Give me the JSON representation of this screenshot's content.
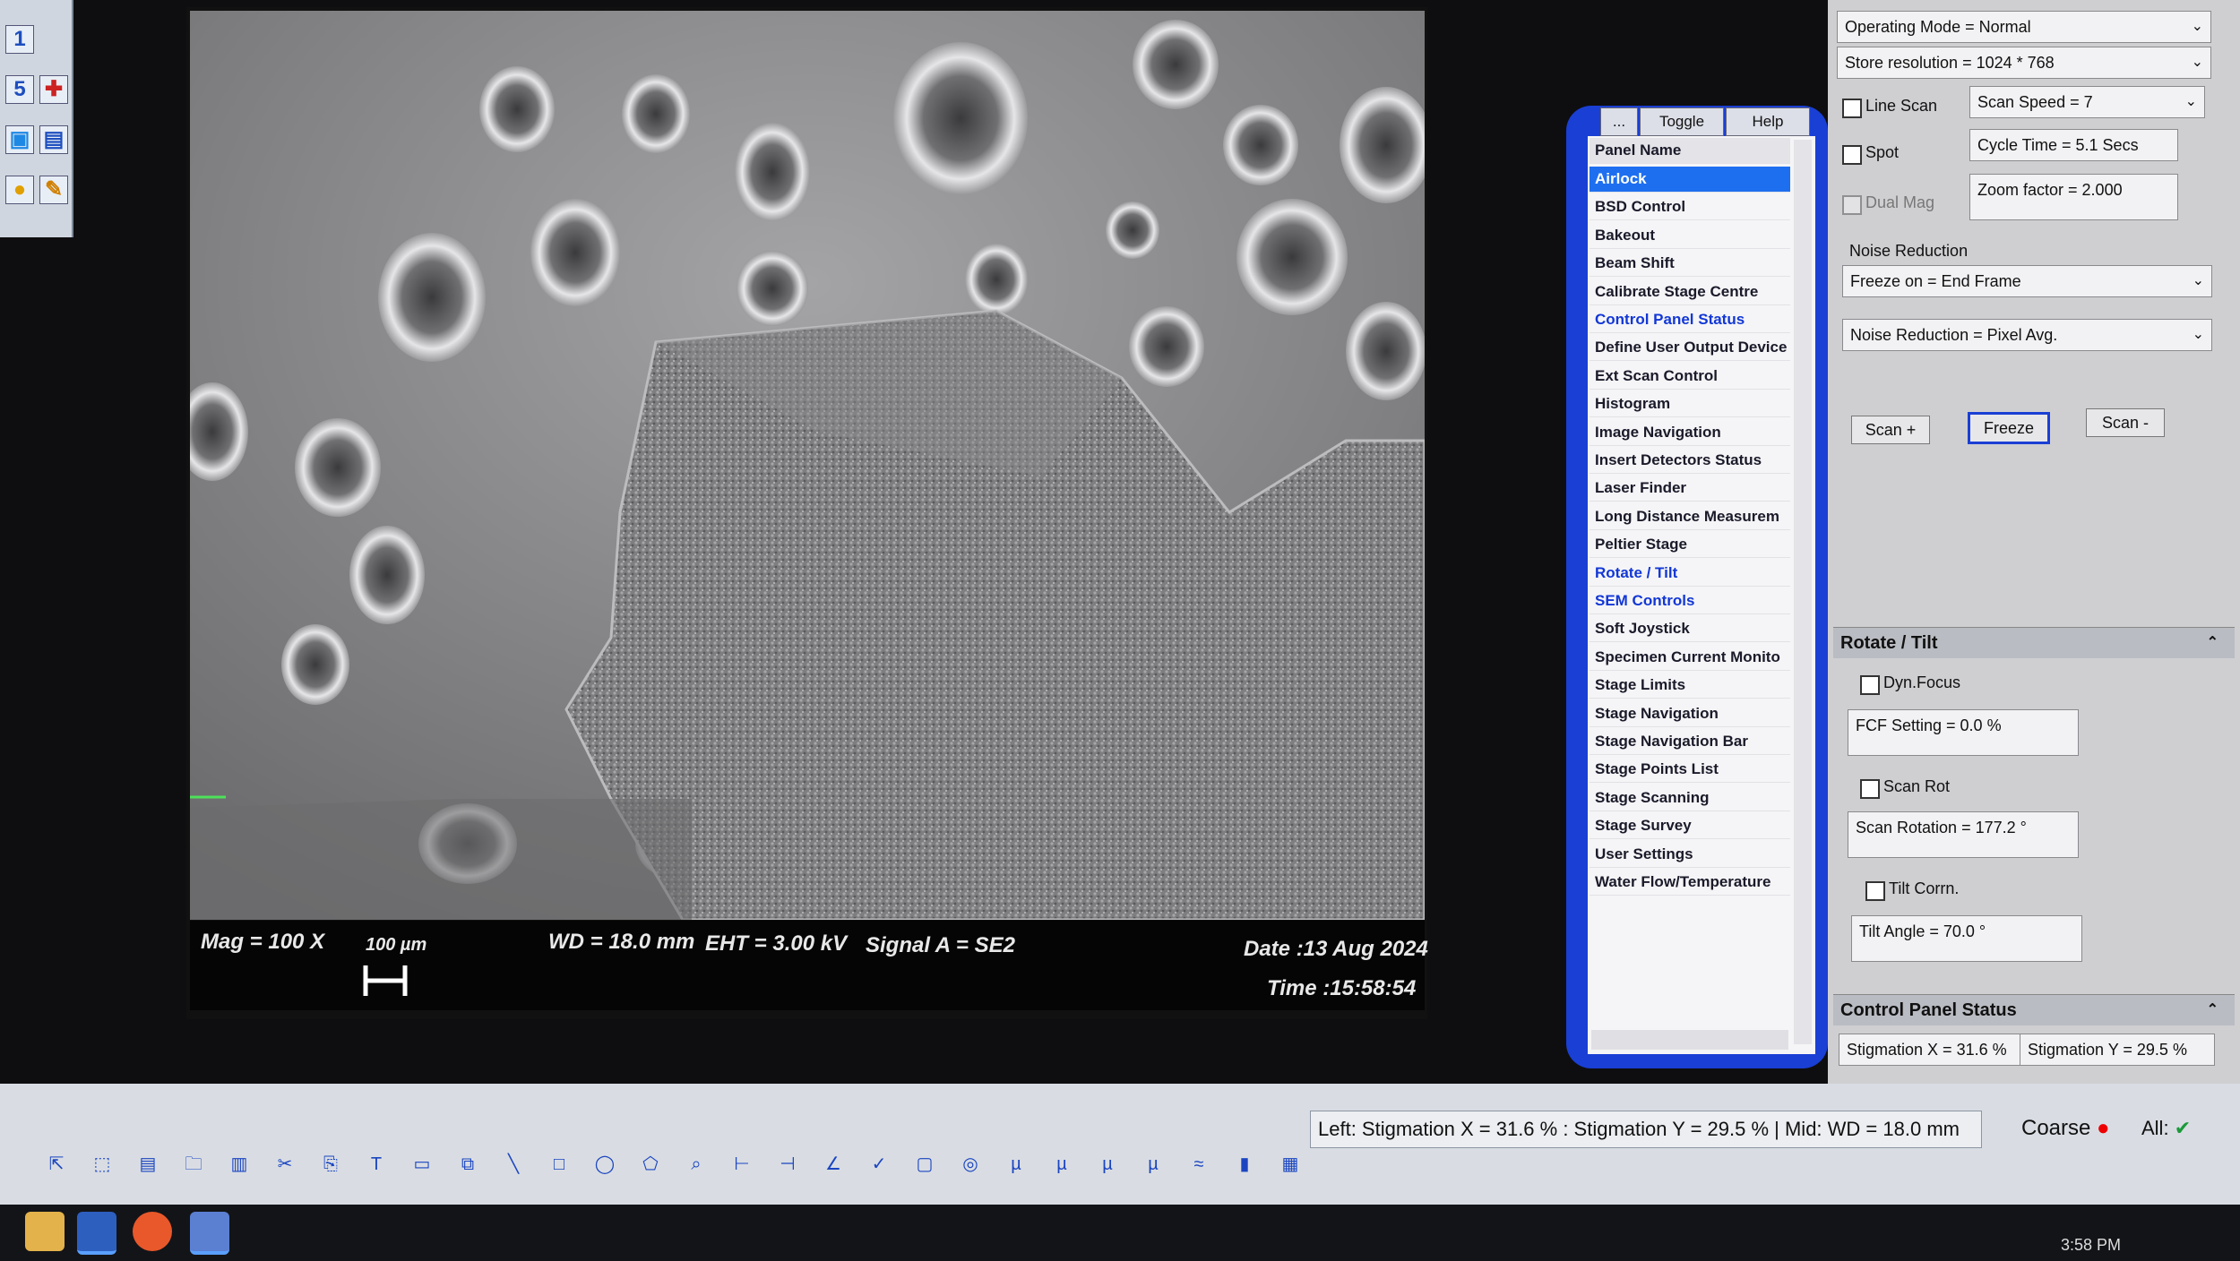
{
  "left_strip": {
    "icons": [
      "1",
      "5"
    ]
  },
  "sem_info": {
    "mag": "Mag =   100 X",
    "scale": "100 µm",
    "wd": "WD = 18.0 mm",
    "eht": "EHT =  3.00 kV",
    "signal": "Signal A = SE2",
    "date": "Date :13 Aug 2024",
    "time": "Time :15:58:54"
  },
  "controls": {
    "operating_mode": "Operating Mode = Normal",
    "store_resolution": "Store resolution = 1024 * 768",
    "line_scan_label": "Line Scan",
    "scan_speed": "Scan Speed = 7",
    "spot_label": "Spot",
    "cycle_time": "Cycle Time = 5.1  Secs",
    "dual_mag_label": "Dual Mag",
    "zoom_factor": "Zoom factor =  2.000",
    "noise_reduction_label": "Noise Reduction",
    "freeze_on": "Freeze on = End Frame",
    "noise_reduction": "Noise Reduction = Pixel Avg.",
    "scan_plus": "Scan +",
    "freeze": "Freeze",
    "scan_minus": "Scan -"
  },
  "rotate_tilt": {
    "title": "Rotate / Tilt",
    "dyn_focus": "Dyn.Focus",
    "fcf_setting": "FCF Setting =   0.0 %",
    "scan_rot": "Scan Rot",
    "scan_rotation": "Scan Rotation = 177.2 °",
    "tilt_corr": "Tilt Corrn.",
    "tilt_angle": "Tilt Angle =  70.0 °"
  },
  "control_panel_status": {
    "title": "Control Panel Status",
    "stigmation_x": "Stigmation X =  31.6 %",
    "stigmation_y": "Stigmation Y =  29.5 %"
  },
  "panel_list": {
    "buttons": [
      "...",
      "Toggle",
      "Help"
    ],
    "header": "Panel Name",
    "items": [
      {
        "label": "Airlock",
        "style": "selected"
      },
      {
        "label": "BSD Control",
        "style": "normal"
      },
      {
        "label": "Bakeout",
        "style": "normal"
      },
      {
        "label": "Beam Shift",
        "style": "normal"
      },
      {
        "label": "Calibrate Stage Centre",
        "style": "normal"
      },
      {
        "label": "Control Panel Status",
        "style": "blue"
      },
      {
        "label": "Define User Output Device",
        "style": "normal"
      },
      {
        "label": "Ext Scan Control",
        "style": "normal"
      },
      {
        "label": "Histogram",
        "style": "normal"
      },
      {
        "label": "Image Navigation",
        "style": "normal"
      },
      {
        "label": "Insert Detectors Status",
        "style": "normal"
      },
      {
        "label": "Laser Finder",
        "style": "normal"
      },
      {
        "label": "Long Distance Measurem",
        "style": "normal"
      },
      {
        "label": "Peltier Stage",
        "style": "normal"
      },
      {
        "label": "Rotate / Tilt",
        "style": "blue"
      },
      {
        "label": "SEM Controls",
        "style": "blue"
      },
      {
        "label": "Soft Joystick",
        "style": "normal"
      },
      {
        "label": "Specimen Current Monito",
        "style": "normal"
      },
      {
        "label": "Stage Limits",
        "style": "normal"
      },
      {
        "label": "Stage Navigation",
        "style": "normal"
      },
      {
        "label": "Stage Navigation Bar",
        "style": "normal"
      },
      {
        "label": "Stage Points List",
        "style": "normal"
      },
      {
        "label": "Stage Scanning",
        "style": "normal"
      },
      {
        "label": "Stage Survey",
        "style": "normal"
      },
      {
        "label": "User Settings",
        "style": "normal"
      },
      {
        "label": "Water Flow/Temperature",
        "style": "normal"
      }
    ]
  },
  "status_bar": {
    "text": "Left: Stigmation X =  31.6 % : Stigmation Y =  29.5 % | Mid: WD = 18.0 mm",
    "coarse": "Coarse",
    "all": "All:"
  },
  "toolbar_icons": [
    "pointer-icon",
    "select-icon",
    "open-icon",
    "folder-icon",
    "save-icon",
    "cut-icon",
    "paste-icon",
    "text-icon",
    "annotate-icon",
    "copy-icon",
    "line-icon",
    "rectangle-icon",
    "ellipse-icon",
    "polygon-icon",
    "zoom-icon",
    "measure-icon",
    "measure2-icon",
    "angle-icon",
    "check-icon",
    "square-icon",
    "circle-icon",
    "mu-icon",
    "mu2-icon",
    "mu3-icon",
    "mu4-icon",
    "graph-icon",
    "histogram-icon",
    "grid-icon"
  ],
  "clock": "3:58 PM",
  "colors": {
    "accent": "#1a3fd4",
    "selected": "#1e6ff0",
    "link_blue": "#1237d6"
  }
}
